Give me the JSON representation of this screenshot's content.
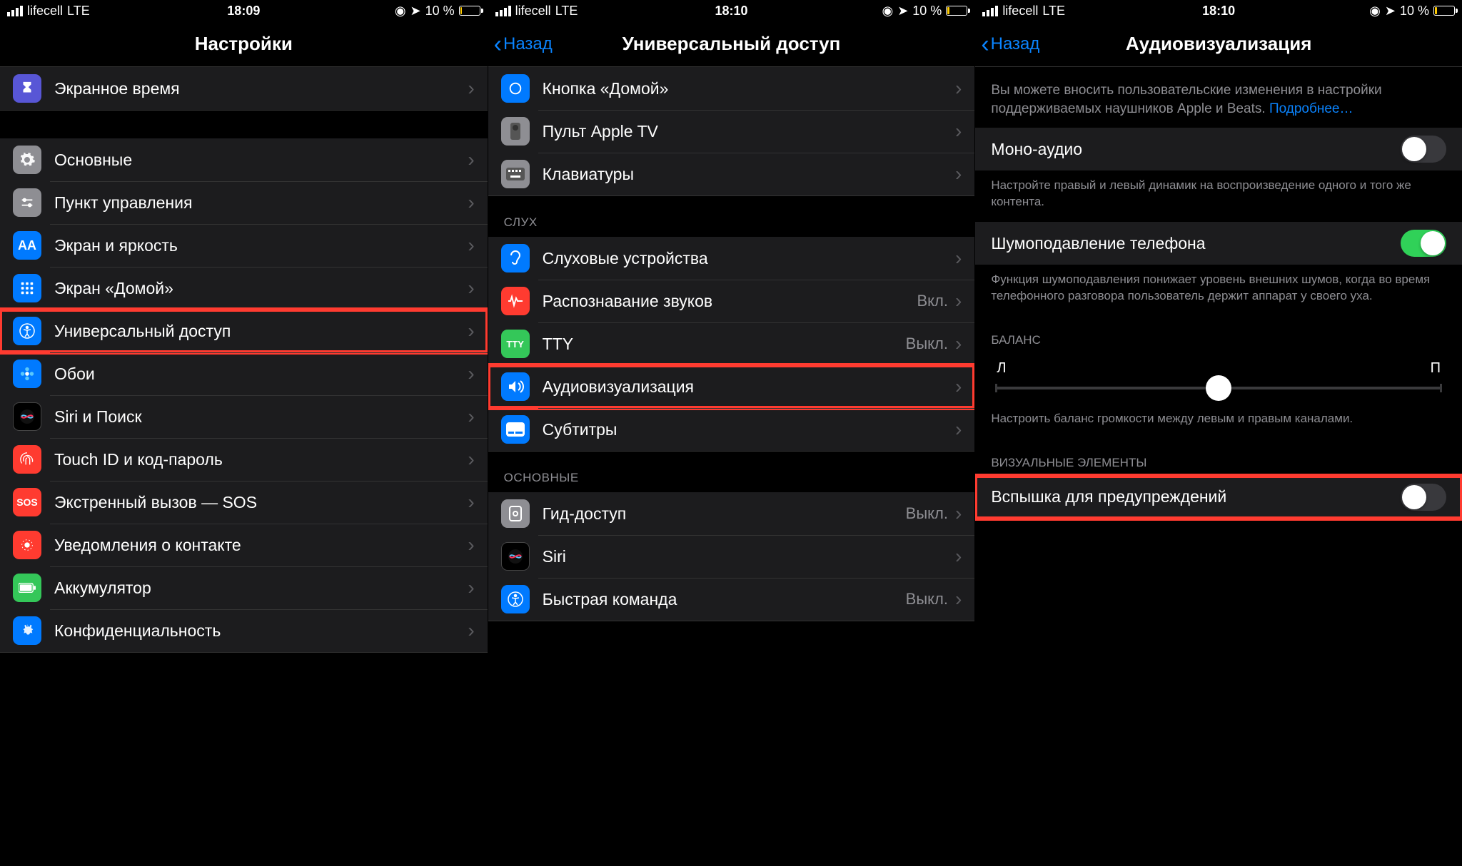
{
  "status": {
    "carrier": "lifecell",
    "net": "LTE",
    "battery": "10 %"
  },
  "times": [
    "18:09",
    "18:10",
    "18:10"
  ],
  "s1": {
    "title": "Настройки",
    "rows_a": [
      {
        "label": "Экранное время",
        "icon": "hourglass",
        "bg": "ic-purple"
      }
    ],
    "rows_b": [
      {
        "label": "Основные",
        "icon": "gear",
        "bg": "ic-gray"
      },
      {
        "label": "Пункт управления",
        "icon": "sliders",
        "bg": "ic-gray"
      },
      {
        "label": "Экран и яркость",
        "icon": "aa",
        "bg": "ic-blue"
      },
      {
        "label": "Экран «Домой»",
        "icon": "grid",
        "bg": "ic-blue"
      },
      {
        "label": "Универсальный доступ",
        "icon": "access",
        "bg": "ic-blue",
        "hl": true
      },
      {
        "label": "Обои",
        "icon": "flower",
        "bg": "ic-blue"
      },
      {
        "label": "Siri и Поиск",
        "icon": "siri",
        "bg": "ic-black"
      },
      {
        "label": "Touch ID и код-пароль",
        "icon": "finger",
        "bg": "ic-red"
      },
      {
        "label": "Экстренный вызов — SOS",
        "icon": "sos",
        "bg": "ic-red"
      },
      {
        "label": "Уведомления о контакте",
        "icon": "exposure",
        "bg": "ic-red"
      },
      {
        "label": "Аккумулятор",
        "icon": "battery",
        "bg": "ic-green"
      },
      {
        "label": "Конфиденциальность",
        "icon": "hand",
        "bg": "ic-blue"
      }
    ]
  },
  "s2": {
    "back": "Назад",
    "title": "Универсальный доступ",
    "section_a": [
      {
        "label": "Кнопка «Домой»",
        "icon": "home",
        "bg": "ic-blue"
      },
      {
        "label": "Пульт Apple TV",
        "icon": "remote",
        "bg": "ic-gray"
      },
      {
        "label": "Клавиатуры",
        "icon": "keyboard",
        "bg": "ic-gray"
      }
    ],
    "header_b": "СЛУХ",
    "section_b": [
      {
        "label": "Слуховые устройства",
        "icon": "ear",
        "bg": "ic-blue"
      },
      {
        "label": "Распознавание звуков",
        "icon": "wave",
        "bg": "ic-red",
        "detail": "Вкл."
      },
      {
        "label": "TTY",
        "icon": "tty",
        "bg": "ic-green",
        "detail": "Выкл."
      },
      {
        "label": "Аудиовизуализация",
        "icon": "audio",
        "bg": "ic-blue",
        "hl": true
      },
      {
        "label": "Субтитры",
        "icon": "cc",
        "bg": "ic-blue"
      }
    ],
    "header_c": "ОСНОВНЫЕ",
    "section_c": [
      {
        "label": "Гид-доступ",
        "icon": "guide",
        "bg": "ic-gray",
        "detail": "Выкл."
      },
      {
        "label": "Siri",
        "icon": "siri",
        "bg": "ic-black"
      },
      {
        "label": "Быстрая команда",
        "icon": "access",
        "bg": "ic-blue",
        "detail": "Выкл."
      }
    ]
  },
  "s3": {
    "back": "Назад",
    "title": "Аудиовизуализация",
    "intro_a": "Вы можете вносить пользовательские изменения в настройки поддерживаемых наушников Apple и Beats. ",
    "intro_link": "Подробнее…",
    "row_mono": "Моно-аудио",
    "foot_mono": "Настройте правый и левый динамик на воспроизведение одного и того же контента.",
    "row_noise": "Шумоподавление телефона",
    "foot_noise": "Функция шумоподавления понижает уровень внешних шумов, когда во время телефонного разговора пользователь держит аппарат у своего уха.",
    "header_balance": "БАЛАНС",
    "balance_l": "Л",
    "balance_r": "П",
    "foot_balance": "Настроить баланс громкости между левым и правым каналами.",
    "header_visual": "ВИЗУАЛЬНЫЕ ЭЛЕМЕНТЫ",
    "row_flash": "Вспышка для предупреждений"
  }
}
